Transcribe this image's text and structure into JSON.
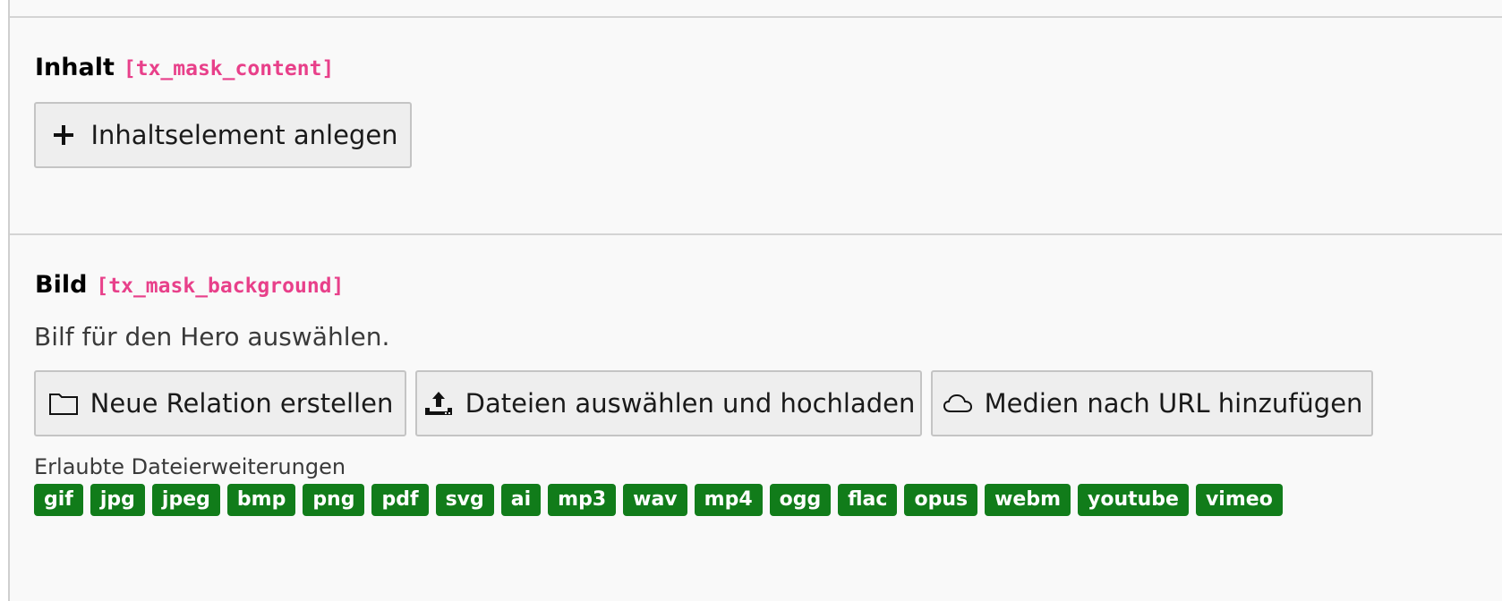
{
  "field_content": {
    "label": "Inhalt",
    "key": "[tx_mask_content]",
    "create_button_label": "Inhaltselement anlegen",
    "create_button_icon": "plus-icon"
  },
  "field_background": {
    "label": "Bild",
    "key": "[tx_mask_background]",
    "description": "Bilf für den Hero auswählen.",
    "buttons": [
      {
        "label": "Neue Relation erstellen",
        "icon": "folder-icon"
      },
      {
        "label": "Dateien auswählen und hochladen",
        "icon": "upload-icon"
      },
      {
        "label": "Medien nach URL hinzufügen",
        "icon": "cloud-icon"
      }
    ],
    "allowed_extensions_title": "Erlaubte Dateierweiterungen",
    "allowed_extensions": [
      "gif",
      "jpg",
      "jpeg",
      "bmp",
      "png",
      "pdf",
      "svg",
      "ai",
      "mp3",
      "wav",
      "mp4",
      "ogg",
      "flac",
      "opus",
      "webm",
      "youtube",
      "vimeo"
    ]
  },
  "colors": {
    "field_key": "#e8408a",
    "badge_background": "#117c1a",
    "panel_background": "#f9f9f9"
  }
}
